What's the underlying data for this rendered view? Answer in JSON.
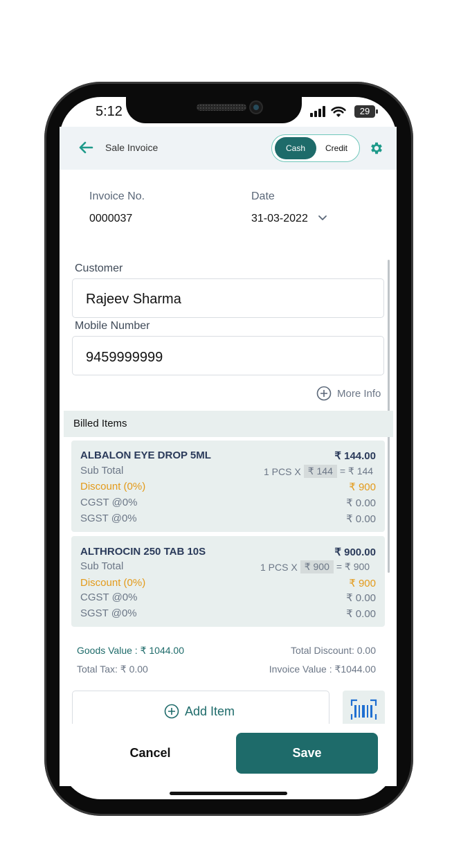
{
  "status": {
    "time": "5:12",
    "battery": "29"
  },
  "header": {
    "title": "Sale Invoice",
    "toggle": {
      "cash": "Cash",
      "credit": "Credit",
      "selected": "Cash"
    }
  },
  "invoice": {
    "number_label": "Invoice No.",
    "number": "0000037",
    "date_label": "Date",
    "date": "31-03-2022"
  },
  "customer": {
    "label": "Customer",
    "value": "Rajeev Sharma"
  },
  "mobile": {
    "label": "Mobile Number",
    "value": "9459999999"
  },
  "more_info": "More Info",
  "billed_items_label": "Billed Items",
  "items": [
    {
      "name": "ALBALON EYE DROP 5ML",
      "amount": "₹ 144.00",
      "subtotal_label": "Sub Total",
      "qty": "1 PCS X",
      "rate": "₹ 144",
      "subtotal": "= ₹ 144",
      "discount_label": "Discount (0%)",
      "discount": "₹ 900",
      "cgst_label": "CGST @0%",
      "cgst": "₹ 0.00",
      "sgst_label": "SGST @0%",
      "sgst": "₹ 0.00"
    },
    {
      "name": "ALTHROCIN 250 TAB 10S",
      "amount": "₹ 900.00",
      "subtotal_label": "Sub Total",
      "qty": "1 PCS X",
      "rate": "₹ 900",
      "subtotal": "= ₹ 900",
      "discount_label": "Discount (0%)",
      "discount": "₹ 900",
      "cgst_label": "CGST @0%",
      "cgst": "₹ 0.00",
      "sgst_label": "SGST @0%",
      "sgst": "₹ 0.00"
    }
  ],
  "summary": {
    "goods_value": "Goods Value : ₹ 1044.00",
    "total_discount": "Total Discount: 0.00",
    "total_tax": "Total Tax: ₹ 0.00",
    "invoice_value": "Invoice Value : ₹1044.00"
  },
  "actions": {
    "add_item": "Add Item",
    "cancel": "Cancel",
    "save": "Save"
  },
  "colors": {
    "primary": "#1e6b6a",
    "discount": "#e39a1a",
    "card_bg": "#e8efee",
    "scan_blue": "#1f6fd1"
  }
}
